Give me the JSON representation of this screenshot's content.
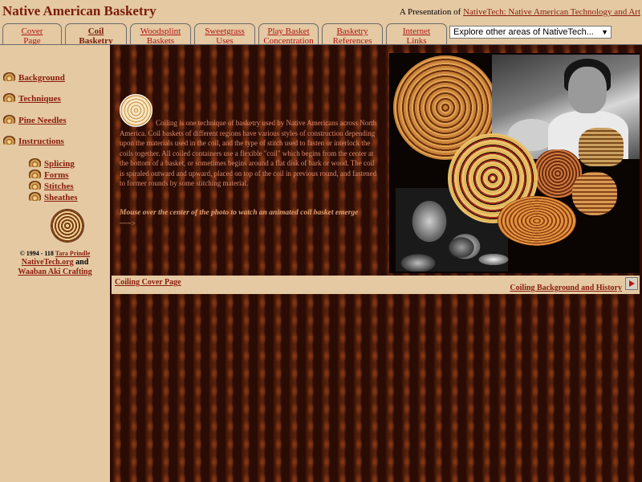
{
  "header": {
    "site_title": "Native American Basketry",
    "presentation_prefix": "A Presentation of ",
    "presentation_link": "NativeTech: Native American Technology and Art"
  },
  "tabs": [
    {
      "label": "Cover\nPage",
      "active": false
    },
    {
      "label": "Coil\nBasketry",
      "active": true
    },
    {
      "label": "Woodsplint\nBaskets",
      "active": false
    },
    {
      "label": "Sweetgrass\nUses",
      "active": false
    },
    {
      "label": "Play Basket\nConcentration",
      "active": false
    },
    {
      "label": "Basketry\nReferences",
      "active": false
    },
    {
      "label": "Internet\nLinks",
      "active": false
    }
  ],
  "explore_select": {
    "value": "Explore other areas of NativeTech..."
  },
  "sidebar": {
    "links": [
      "Background",
      "Techniques",
      "Pine Needles",
      "Instructions"
    ],
    "sublinks": [
      "Splicing",
      "Forms",
      "Stitches",
      "Sheathes"
    ],
    "copyright_prefix": "© 1994 - 118 ",
    "copyright_author": "Tara Prindle",
    "site_link": "NativeTech.org",
    "and_text": " and",
    "waaban_link": "Waaban Aki Crafting"
  },
  "main": {
    "body": "Coiling is one technique of basketry used by Native Americans across North America. Coil baskets of different regions have various styles of construction depending upon the materials used in the coil, and the type of stitch used to fasten or interlock the coils together. All coiled containers use a flexible \"coil\" which begins from the center at the bottom of a basket, or sometimes begins around a flat disk of bark or wood. The coil is spiraled outward and upward, placed on top of the coil in previous round, and fastened to former rounds by some stitching material.",
    "hint": "Mouse over the center of the photo to watch an animated coil basket emerge",
    "arrow": "~~~>"
  },
  "nav": {
    "prev": "Coiling Cover Page",
    "next": "Coiling Background and History"
  },
  "colors": {
    "background": "#e4c9a3",
    "link": "#8a1c0c",
    "tab_link": "#b01414",
    "body_text": "#e08a6a"
  }
}
